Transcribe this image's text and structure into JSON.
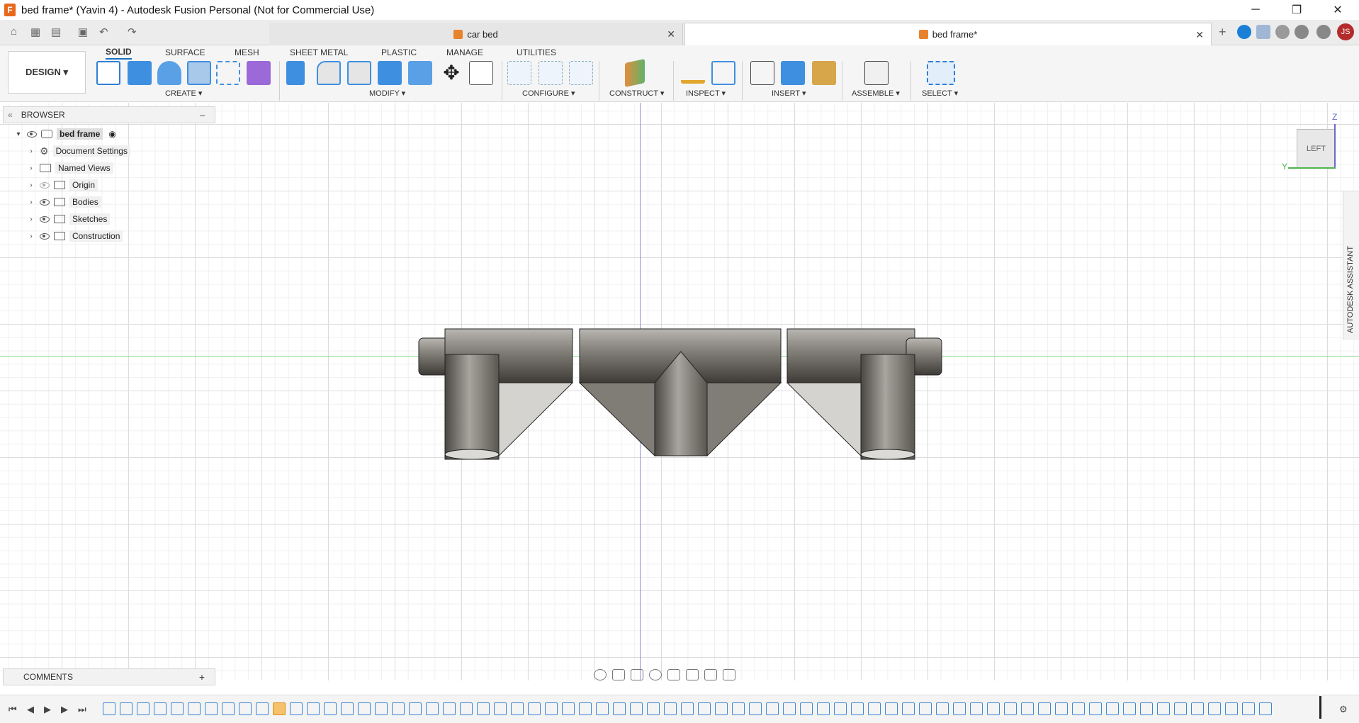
{
  "window": {
    "title": "bed frame* (Yavin 4) - Autodesk Fusion Personal (Not for Commercial Use)",
    "app_icon_letter": "F",
    "minimize": "─",
    "restore": "❐",
    "close": "✕"
  },
  "tabs": [
    {
      "label": "car bed",
      "active": false
    },
    {
      "label": "bed frame*",
      "active": true
    }
  ],
  "tab_close": "✕",
  "tab_add": "+",
  "user_initials": "JS",
  "workspace": {
    "label": "DESIGN ▾"
  },
  "ribbon_tabs": [
    "SOLID",
    "SURFACE",
    "MESH",
    "SHEET METAL",
    "PLASTIC",
    "MANAGE",
    "UTILITIES"
  ],
  "tool_groups": [
    "CREATE ▾",
    "MODIFY ▾",
    "CONFIGURE ▾",
    "CONSTRUCT ▾",
    "INSPECT ▾",
    "INSERT ▾",
    "ASSEMBLE ▾",
    "SELECT ▾"
  ],
  "browser": {
    "header": "BROWSER",
    "collapse": "–",
    "root": "bed frame",
    "items": [
      {
        "label": "Document Settings",
        "icon": "gear-icon",
        "visible": true
      },
      {
        "label": "Named Views",
        "icon": "folder-icon",
        "visible": true
      },
      {
        "label": "Origin",
        "icon": "folder-icon",
        "visible": false
      },
      {
        "label": "Bodies",
        "icon": "folder-icon",
        "visible": true
      },
      {
        "label": "Sketches",
        "icon": "folder-icon",
        "visible": true
      },
      {
        "label": "Construction",
        "icon": "folder-icon",
        "visible": true
      }
    ]
  },
  "viewcube": {
    "face": "LEFT",
    "axis_z": "Z",
    "axis_y": "Y"
  },
  "assistant": {
    "label": "AUTODESK ASSISTANT"
  },
  "comments": {
    "label": "COMMENTS",
    "add": "+"
  },
  "colors": {
    "accent": "#1a6fc0",
    "axis_x": "#8fdb8f",
    "axis_z": "#8f8fd8",
    "body": "#8a8680"
  }
}
